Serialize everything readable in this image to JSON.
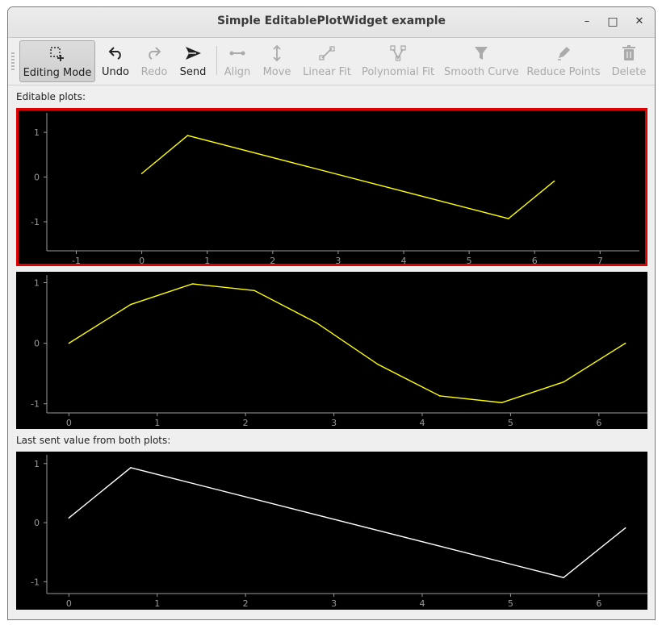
{
  "window": {
    "title": "Simple EditablePlotWidget example"
  },
  "titlebar_buttons": {
    "minimize": "–",
    "maximize": "□",
    "close": "✕"
  },
  "toolbar": [
    {
      "id": "editing-mode",
      "label": "Editing Mode",
      "icon": "select-add-icon",
      "enabled": true,
      "active": true
    },
    {
      "id": "undo",
      "label": "Undo",
      "icon": "undo-icon",
      "enabled": true
    },
    {
      "id": "redo",
      "label": "Redo",
      "icon": "redo-icon",
      "enabled": false
    },
    {
      "id": "send",
      "label": "Send",
      "icon": "send-icon",
      "enabled": true
    },
    {
      "id": "align",
      "label": "Align",
      "icon": "align-icon",
      "enabled": false
    },
    {
      "id": "move",
      "label": "Move",
      "icon": "move-vertical-icon",
      "enabled": false
    },
    {
      "id": "linear-fit",
      "label": "Linear Fit",
      "icon": "linear-fit-icon",
      "enabled": false
    },
    {
      "id": "polynomial-fit",
      "label": "Polynomial Fit",
      "icon": "polynomial-fit-icon",
      "enabled": false
    },
    {
      "id": "smooth-curve",
      "label": "Smooth Curve",
      "icon": "filter-icon",
      "enabled": false
    },
    {
      "id": "reduce-points",
      "label": "Reduce Points",
      "icon": "pencil-icon",
      "enabled": false
    },
    {
      "id": "delete",
      "label": "Delete",
      "icon": "trash-icon",
      "enabled": false
    }
  ],
  "labels": {
    "editable_plots": "Editable plots:",
    "last_sent": "Last sent value from both plots:"
  },
  "colors": {
    "editable_line": "#ffff00",
    "sent_line": "#ffffff",
    "selected_border": "#e00000",
    "axis": "#9a9a9a"
  },
  "chart_data": [
    {
      "type": "line",
      "selected": true,
      "xlim": [
        -1.45,
        7.6
      ],
      "ylim": [
        -1.65,
        1.4
      ],
      "xticks": [
        -1,
        0,
        1,
        2,
        3,
        4,
        5,
        6,
        7
      ],
      "yticks": [
        1,
        0,
        -1
      ],
      "series": [
        {
          "color": "#ffff00",
          "x": [
            0,
            0.7,
            5.6,
            6.3
          ],
          "y": [
            0.08,
            0.93,
            -0.93,
            -0.09
          ]
        }
      ]
    },
    {
      "type": "line",
      "selected": false,
      "xlim": [
        -0.25,
        6.55
      ],
      "ylim": [
        -1.15,
        1.1
      ],
      "xticks": [
        0,
        1,
        2,
        3,
        4,
        5,
        6
      ],
      "yticks": [
        1,
        0,
        -1
      ],
      "series": [
        {
          "color": "#ffff00",
          "x": [
            0,
            0.7,
            1.4,
            2.1,
            2.8,
            3.5,
            4.2,
            4.9,
            5.6,
            6.3
          ],
          "y": [
            0,
            0.64,
            0.98,
            0.87,
            0.34,
            -0.35,
            -0.87,
            -0.98,
            -0.64,
            0
          ]
        }
      ]
    },
    {
      "type": "line",
      "selected": false,
      "xlim": [
        -0.25,
        6.55
      ],
      "ylim": [
        -1.2,
        1.12
      ],
      "xticks": [
        0,
        1,
        2,
        3,
        4,
        5,
        6
      ],
      "yticks": [
        1,
        0,
        -1
      ],
      "series": [
        {
          "color": "#ffffff",
          "x": [
            0,
            0.7,
            5.6,
            6.3
          ],
          "y": [
            0.08,
            0.93,
            -0.93,
            -0.09
          ]
        }
      ]
    }
  ]
}
